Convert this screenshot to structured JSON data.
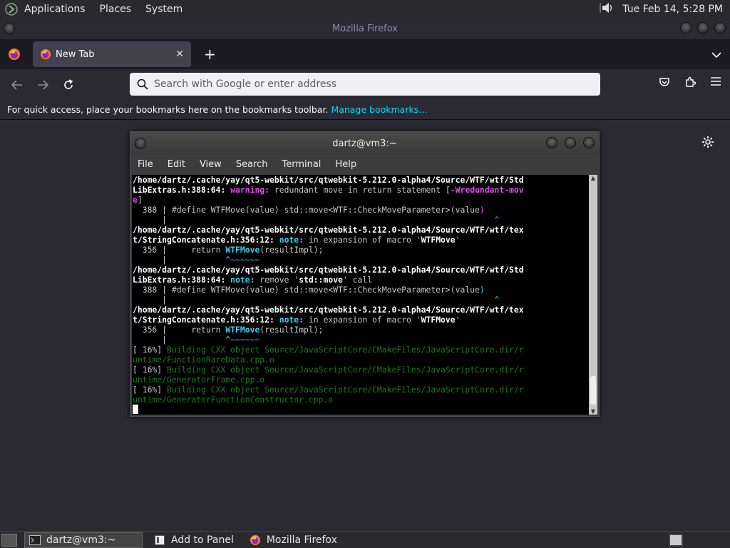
{
  "topbar": {
    "menus": [
      "Applications",
      "Places",
      "System"
    ],
    "clock": "Tue Feb 14,  5:28 PM"
  },
  "window": {
    "title": "Mozilla Firefox"
  },
  "tabs": [
    {
      "label": "New Tab"
    }
  ],
  "urlbar": {
    "placeholder": "Search with Google or enter address"
  },
  "bookmarks": {
    "message": "For quick access, place your bookmarks here on the bookmarks toolbar.",
    "link": "Manage bookmarks…"
  },
  "terminal": {
    "title": "dartz@vm3:~",
    "menu": [
      "File",
      "Edit",
      "View",
      "Search",
      "Terminal",
      "Help"
    ],
    "lines": [
      [
        {
          "t": "/home/dartz/.cache/yay/qt5-webkit/src/qtwebkit-5.212.0-alpha4/Source/WTF/wtf/Std",
          "c": "b"
        }
      ],
      [
        {
          "t": "LibExtras.h:388:64: ",
          "c": "b"
        },
        {
          "t": "warning: ",
          "c": "warn"
        },
        {
          "t": "redundant move in return statement [",
          "c": ""
        },
        {
          "t": "-Wredundant-mov",
          "c": "warn"
        }
      ],
      [
        {
          "t": "e",
          "c": "warn"
        },
        {
          "t": "]",
          "c": ""
        }
      ],
      [
        {
          "t": "  388 | #define WTFMove(value) std::move<WTF::CheckMoveParameter>(value",
          "c": ""
        },
        {
          "t": ")",
          "c": "mag"
        }
      ],
      [
        {
          "t": "      |                                                                   ",
          "c": ""
        },
        {
          "t": "^",
          "c": "mag"
        }
      ],
      [
        {
          "t": "/home/dartz/.cache/yay/qt5-webkit/src/qtwebkit-5.212.0-alpha4/Source/WTF/wtf/tex",
          "c": "b"
        }
      ],
      [
        {
          "t": "t/StringConcatenate.h:356:12: ",
          "c": "b"
        },
        {
          "t": "note: ",
          "c": "note"
        },
        {
          "t": "in expansion of macro '",
          "c": ""
        },
        {
          "t": "WTFMove",
          "c": "b"
        },
        {
          "t": "'",
          "c": ""
        }
      ],
      [
        {
          "t": "  356 |     return ",
          "c": ""
        },
        {
          "t": "WTFMove",
          "c": "note"
        },
        {
          "t": "(resultImpl);",
          "c": ""
        }
      ],
      [
        {
          "t": "      |            ",
          "c": ""
        },
        {
          "t": "^~~~~~~",
          "c": "cy"
        }
      ],
      [
        {
          "t": "/home/dartz/.cache/yay/qt5-webkit/src/qtwebkit-5.212.0-alpha4/Source/WTF/wtf/Std",
          "c": "b"
        }
      ],
      [
        {
          "t": "LibExtras.h:388:64: ",
          "c": "b"
        },
        {
          "t": "note: ",
          "c": "note"
        },
        {
          "t": "remove '",
          "c": ""
        },
        {
          "t": "std::move",
          "c": "b"
        },
        {
          "t": "' call",
          "c": ""
        }
      ],
      [
        {
          "t": "  388 | #define WTFMove(value) std::move<WTF::CheckMoveParameter>(value",
          "c": ""
        },
        {
          "t": ")",
          "c": "cy"
        }
      ],
      [
        {
          "t": "      |                                                                   ",
          "c": ""
        },
        {
          "t": "^",
          "c": "cy"
        }
      ],
      [
        {
          "t": "/home/dartz/.cache/yay/qt5-webkit/src/qtwebkit-5.212.0-alpha4/Source/WTF/wtf/tex",
          "c": "b"
        }
      ],
      [
        {
          "t": "t/StringConcatenate.h:356:12: ",
          "c": "b"
        },
        {
          "t": "note: ",
          "c": "note"
        },
        {
          "t": "in expansion of macro '",
          "c": ""
        },
        {
          "t": "WTFMove",
          "c": "b"
        },
        {
          "t": "'",
          "c": ""
        }
      ],
      [
        {
          "t": "  356 |     return ",
          "c": ""
        },
        {
          "t": "WTFMove",
          "c": "note"
        },
        {
          "t": "(resultImpl);",
          "c": ""
        }
      ],
      [
        {
          "t": "      |            ",
          "c": ""
        },
        {
          "t": "^~~~~~~",
          "c": "cy"
        }
      ],
      [
        {
          "t": "[ 16%] ",
          "c": ""
        },
        {
          "t": "Building CXX object Source/JavaScriptCore/CMakeFiles/JavaScriptCore.dir/r",
          "c": "gr"
        }
      ],
      [
        {
          "t": "untime/FunctionRareData.cpp.o",
          "c": "gr"
        }
      ],
      [
        {
          "t": "[ 16%] ",
          "c": ""
        },
        {
          "t": "Building CXX object Source/JavaScriptCore/CMakeFiles/JavaScriptCore.dir/r",
          "c": "gr"
        }
      ],
      [
        {
          "t": "untime/GeneratorFrame.cpp.o",
          "c": "gr"
        }
      ],
      [
        {
          "t": "[ 16%] ",
          "c": ""
        },
        {
          "t": "Building CXX object Source/JavaScriptCore/CMakeFiles/JavaScriptCore.dir/r",
          "c": "gr"
        }
      ],
      [
        {
          "t": "untime/GeneratorFunctionConstructor.cpp.o",
          "c": "gr"
        }
      ]
    ]
  },
  "taskbar": {
    "items": [
      {
        "label": "dartz@vm3:~",
        "icon": "terminal-icon"
      },
      {
        "label": "Add to Panel",
        "icon": "panel-icon"
      },
      {
        "label": "Mozilla Firefox",
        "icon": "firefox-icon"
      }
    ]
  }
}
